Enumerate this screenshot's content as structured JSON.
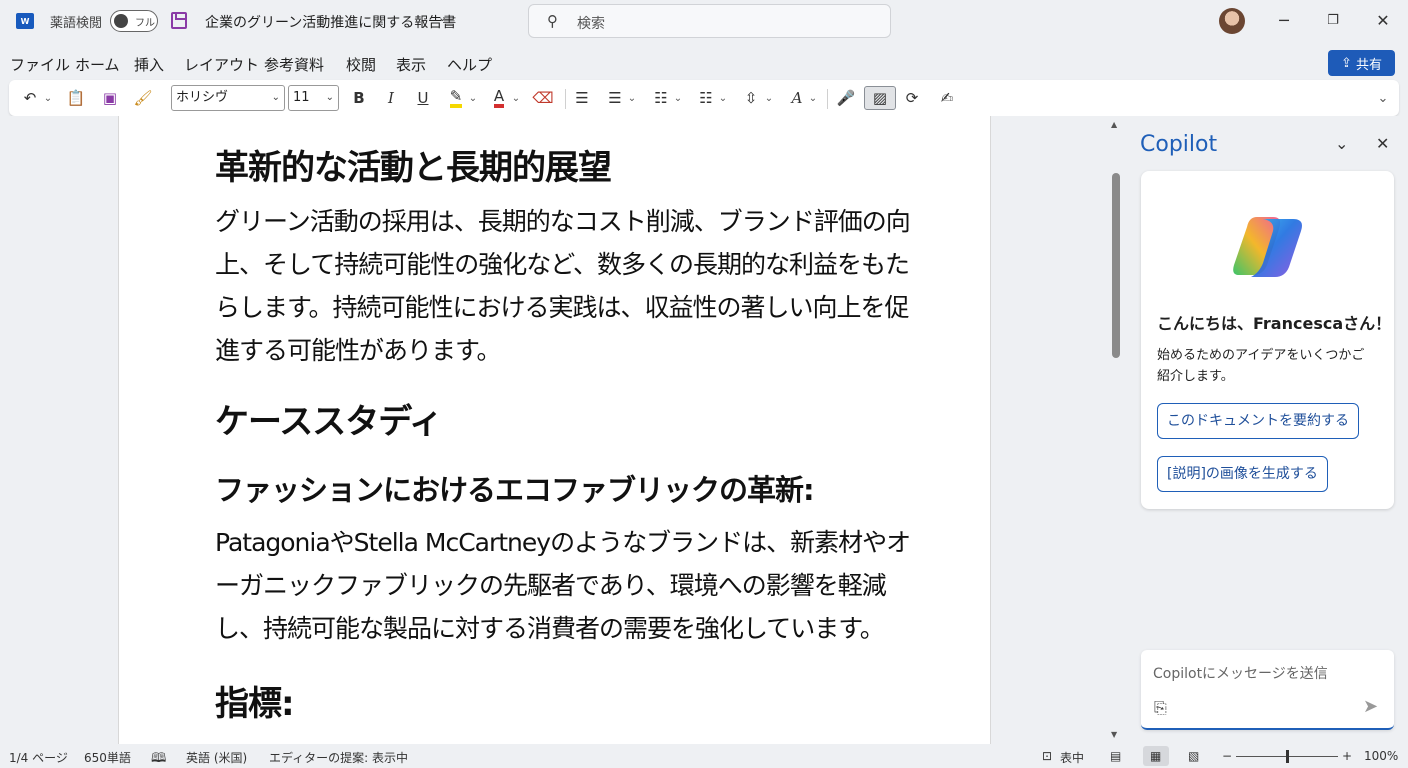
{
  "titlebar": {
    "app_icon": "word-icon",
    "accessibility_label": "薬語検閲",
    "toggle_label": "フル",
    "doc_title": "企業のグリーン活動推進に関する報告書",
    "search_placeholder": "検索",
    "window_buttons": [
      "minimize-icon",
      "restore-icon",
      "close-icon"
    ]
  },
  "menu": {
    "items": [
      "ファイル",
      "ホーム",
      "挿入",
      "レイアウト",
      "参考資料",
      "校閲",
      "表示",
      "ヘルプ"
    ],
    "share_label": "共有"
  },
  "ribbon": {
    "font_name": "ホリシヴ",
    "font_size": "11",
    "bold": "B",
    "italic": "I",
    "underline": "U",
    "font_color_label": "A",
    "style_label": "A",
    "highlight_color": "#f5d800",
    "font_color": "#d32f2f"
  },
  "document": {
    "heading1": "革新的な活動と長期的展望",
    "para1": "グリーン活動の採用は、長期的なコスト削減、ブランド評価の向上、そして持続可能性の強化など、数多くの長期的な利益をもたらします。持続可能性における実践は、収益性の著しい向上を促進する可能性があります。",
    "heading2": "ケーススタディ",
    "subheading": "ファッションにおけるエコファブリックの革新:",
    "para2": "PatagoniaやStella McCartneyのようなブランドは、新素材やオーガニックファブリックの先駆者であり、環境への影響を軽減し、持続可能な製品に対する消費者の需要を強化しています。",
    "heading3": "指標:"
  },
  "copilot": {
    "title": "Copilot",
    "greeting": "こんにちは、Francescaさん！",
    "intro": "始めるためのアイデアをいくつかご紹介します。",
    "suggestions": [
      "このドキュメントを要約する",
      "[説明]の画像を生成する"
    ],
    "input_placeholder": "Copilotにメッセージを送信"
  },
  "statusbar": {
    "page": "1/4 ページ",
    "words": "650単語",
    "language": "英語 (米国)",
    "editor": "エディターの提案: 表示中",
    "focus": "表中",
    "zoom": "100%",
    "zoom_fraction": 0.5
  }
}
